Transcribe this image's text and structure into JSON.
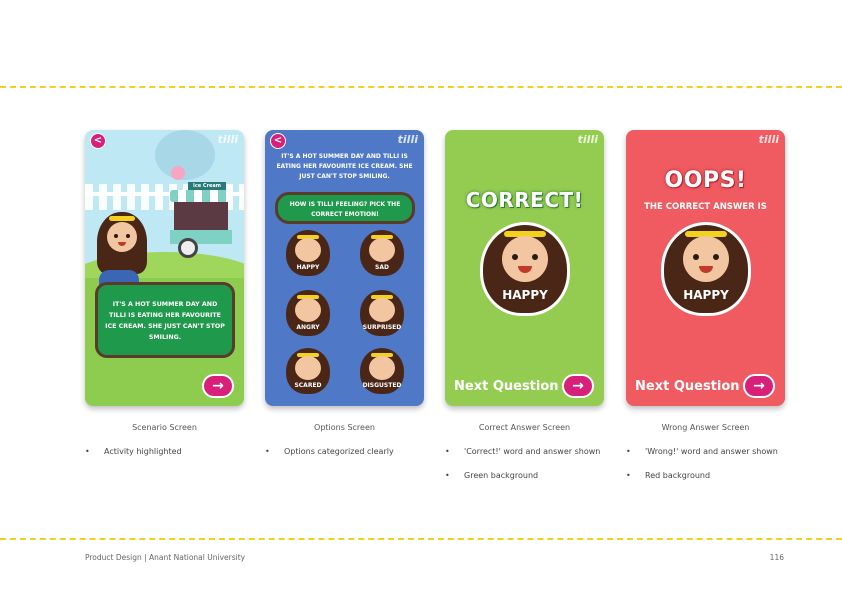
{
  "brand": "tilli",
  "back_glyph": "<",
  "arrow_glyph": "→",
  "scenario_text": "It's a hot summer day and Tilli is eating her favourite ice cream. She just can't stop smiling.",
  "cards": {
    "scenario": {
      "sign": "Ice Cream",
      "caption": "Scenario Screen",
      "bullets": [
        "Activity highlighted"
      ]
    },
    "options": {
      "question": "How is Tilli feeling? Pick the correct emotion!",
      "emotions": [
        "HAPPY",
        "SAD",
        "ANGRY",
        "SURPRISED",
        "SCARED",
        "DISGUSTED"
      ],
      "caption": "Options Screen",
      "bullets": [
        "Options categorized clearly"
      ]
    },
    "correct": {
      "title": "CORRECT!",
      "face_label": "HAPPY",
      "next_label": "Next Question",
      "caption": "Correct Answer Screen",
      "bullets": [
        "'Correct!' word and answer shown",
        "Green background"
      ]
    },
    "wrong": {
      "title": "OOPS!",
      "subtitle": "The correct answer is",
      "face_label": "HAPPY",
      "next_label": "Next Question",
      "caption": "Wrong Answer Screen",
      "bullets": [
        "'Wrong!' word and answer shown",
        "Red background"
      ]
    }
  },
  "footer": {
    "left": "Product Design | Anant National University",
    "page": "116"
  },
  "colors": {
    "dash": "#f2d21f",
    "green_bg": "#94cc52",
    "red_bg": "#ef5b60",
    "blue_bg": "#4f79c6",
    "accent": "#d8207a"
  }
}
